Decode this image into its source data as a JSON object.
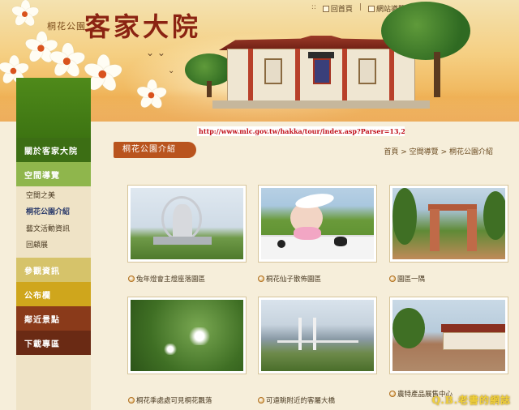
{
  "header": {
    "brand_small": "桐花公園",
    "brand_big": "客家大院",
    "links": [
      "回首頁",
      "網站導覽"
    ],
    "separator": "|"
  },
  "url_overlay": "http://www.mlc.gov.tw/hakka/tour/index.asp?Parser=13,23,169,161",
  "sidebar": {
    "about": "關於客家大院",
    "space": "空間導覽",
    "sub_items": [
      "空間之美",
      "桐花公園介紹",
      "藝文活動資訊",
      "回顧展"
    ],
    "active_sub": "桐花公園介紹",
    "visit": "參觀資訊",
    "board": "公布欄",
    "nearby": "鄰近景點",
    "download": "下載專區"
  },
  "main": {
    "section_title": "桐花公園介紹",
    "breadcrumb": [
      "首頁",
      "空間導覽",
      "桐花公園介紹"
    ],
    "breadcrumb_sep": ">",
    "gallery": [
      {
        "caption": "兔年燈會主燈座落園區"
      },
      {
        "caption": "桐花仙子散佈園區"
      },
      {
        "caption": "園區一隅"
      },
      {
        "caption": "桐花季處處可見桐花飄落"
      },
      {
        "caption": "可遠眺附近的客屬大橋"
      },
      {
        "caption": "農特產品展售中心"
      }
    ]
  },
  "watermark": "Q.B.老書的網誌",
  "colors": {
    "header_gold": "#f0b55a",
    "sidebar_green": "#3c6e14",
    "title_brown": "#b9541e",
    "url_red": "#c0101a"
  }
}
